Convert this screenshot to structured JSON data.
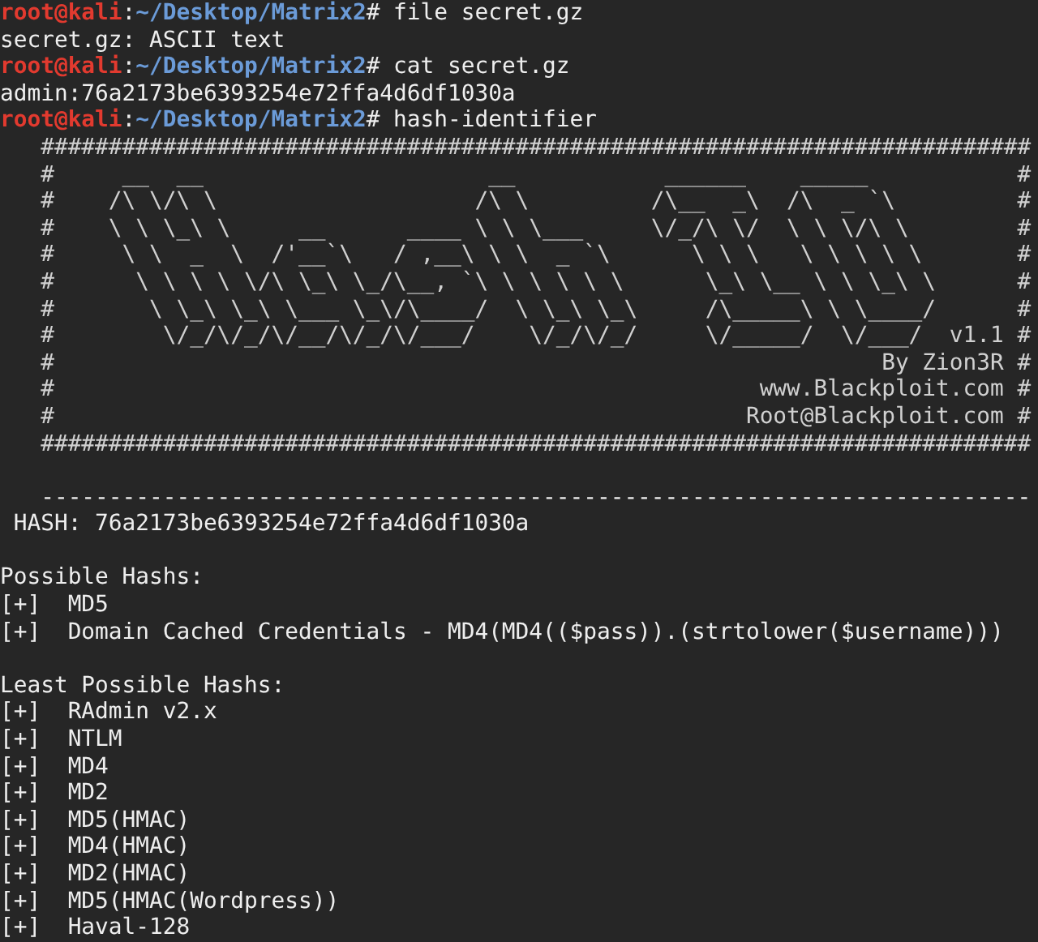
{
  "terminal": {
    "lines": [
      {
        "kind": "prompt",
        "user": "root@kali",
        "separator": ":",
        "path": "~/Desktop/Matrix2",
        "sign": "#",
        "command": "file secret.gz"
      },
      {
        "kind": "output",
        "text": "secret.gz: ASCII text"
      },
      {
        "kind": "prompt",
        "user": "root@kali",
        "separator": ":",
        "path": "~/Desktop/Matrix2",
        "sign": "#",
        "command": "cat secret.gz"
      },
      {
        "kind": "output",
        "text": "admin:76a2173be6393254e72ffa4d6df1030a"
      },
      {
        "kind": "prompt",
        "user": "root@kali",
        "separator": ":",
        "path": "~/Desktop/Matrix2",
        "sign": "#",
        "command": "hash-identifier"
      },
      {
        "kind": "banner",
        "text": "   #########################################################################"
      },
      {
        "kind": "banner",
        "text": "   #     __  __                     __           ______    _____           #"
      },
      {
        "kind": "banner",
        "text": "   #    /\\ \\/\\ \\                   /\\ \\         /\\__  _\\  /\\  _ `\\         #"
      },
      {
        "kind": "banner",
        "text": "   #    \\ \\ \\_\\ \\     __      ____ \\ \\ \\___     \\/_/\\ \\/  \\ \\ \\/\\ \\        #"
      },
      {
        "kind": "banner",
        "text": "   #     \\ \\  _  \\  /'__`\\   / ,__\\ \\ \\  _ `\\      \\ \\ \\   \\ \\ \\ \\ \\       #"
      },
      {
        "kind": "banner",
        "text": "   #      \\ \\ \\ \\ \\/\\ \\_\\ \\_/\\__, `\\ \\ \\ \\ \\ \\      \\_\\ \\__ \\ \\ \\_\\ \\      #"
      },
      {
        "kind": "banner",
        "text": "   #       \\ \\_\\ \\_\\ \\___ \\_\\/\\____/  \\ \\_\\ \\_\\     /\\_____\\ \\ \\____/      #"
      },
      {
        "kind": "banner",
        "text": "   #        \\/_/\\/_/\\/__/\\/_/\\/___/    \\/_/\\/_/     \\/_____/  \\/___/  v1.1 #"
      },
      {
        "kind": "banner",
        "text": "   #                                                             By Zion3R #"
      },
      {
        "kind": "banner",
        "text": "   #                                                    www.Blackploit.com #"
      },
      {
        "kind": "banner",
        "text": "   #                                                   Root@Blackploit.com #"
      },
      {
        "kind": "banner",
        "text": "   #########################################################################"
      },
      {
        "kind": "blank"
      },
      {
        "kind": "output",
        "text": "   -------------------------------------------------------------------------"
      },
      {
        "kind": "output",
        "text": " HASH: 76a2173be6393254e72ffa4d6df1030a"
      },
      {
        "kind": "blank"
      },
      {
        "kind": "output",
        "text": "Possible Hashs:"
      },
      {
        "kind": "output",
        "text": "[+]  MD5"
      },
      {
        "kind": "output",
        "text": "[+]  Domain Cached Credentials - MD4(MD4(($pass)).(strtolower($username)))"
      },
      {
        "kind": "blank"
      },
      {
        "kind": "output",
        "text": "Least Possible Hashs:"
      },
      {
        "kind": "output",
        "text": "[+]  RAdmin v2.x"
      },
      {
        "kind": "output",
        "text": "[+]  NTLM"
      },
      {
        "kind": "output",
        "text": "[+]  MD4"
      },
      {
        "kind": "output",
        "text": "[+]  MD2"
      },
      {
        "kind": "output",
        "text": "[+]  MD5(HMAC)"
      },
      {
        "kind": "output",
        "text": "[+]  MD4(HMAC)"
      },
      {
        "kind": "output",
        "text": "[+]  MD2(HMAC)"
      },
      {
        "kind": "output",
        "text": "[+]  MD5(HMAC(Wordpress))"
      },
      {
        "kind": "output",
        "text": "[+]  Haval-128"
      }
    ]
  }
}
